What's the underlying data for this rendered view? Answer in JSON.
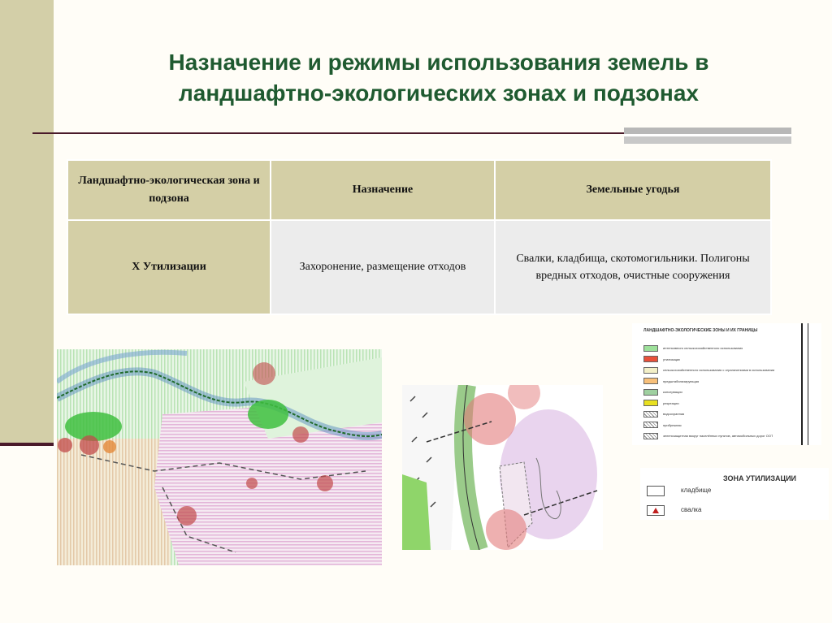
{
  "slide": {
    "title": "Назначение и режимы использования земель в ландшафтно-экологических зонах и подзонах"
  },
  "table": {
    "headers": [
      "Ландшафтно-экологическая зона и подзона",
      "Назначение",
      "Земельные угодья"
    ],
    "rows": [
      {
        "zone": "X Утилизации",
        "purpose": "Захоронение, размещение отходов",
        "lands": "Свалки, кладбища, скотомогильники. Полигоны вредных отходов, очистные сооружения"
      }
    ]
  },
  "legend_zones": {
    "title": "ЛАНДШАФТНО-ЭКОЛОГИЧЕСКИЕ ЗОНЫ И ИХ ГРАНИЦЫ",
    "items": [
      {
        "color": "#9de09a",
        "label": "интенсивного сельскохозяйственного использования"
      },
      {
        "color": "#e8503a",
        "label": "утилизации"
      },
      {
        "color": "#f3f0c8",
        "label": "сельскохозяйственного использования с ограничениями в использовании"
      },
      {
        "color": "#f8c07a",
        "label": "предштабилизирующая"
      },
      {
        "color": "#9fd0a0",
        "label": "консервации"
      },
      {
        "color": "#e8e020",
        "label": "рекреации"
      },
      {
        "color": "#ffffff",
        "label": "водоохранная"
      },
      {
        "color": "#ffffff",
        "label": "прибрежная"
      },
      {
        "color": "#ffffff",
        "label": "зеленозащитная вокруг населённых пунктов, автомобильных дорог ООТ"
      }
    ]
  },
  "legend_util": {
    "title": "ЗОНА УТИЛИЗАЦИИ",
    "items": [
      {
        "label": "кладбище",
        "icon": "cemetery-icon"
      },
      {
        "label": "свалка",
        "icon": "landfill-icon"
      }
    ]
  }
}
